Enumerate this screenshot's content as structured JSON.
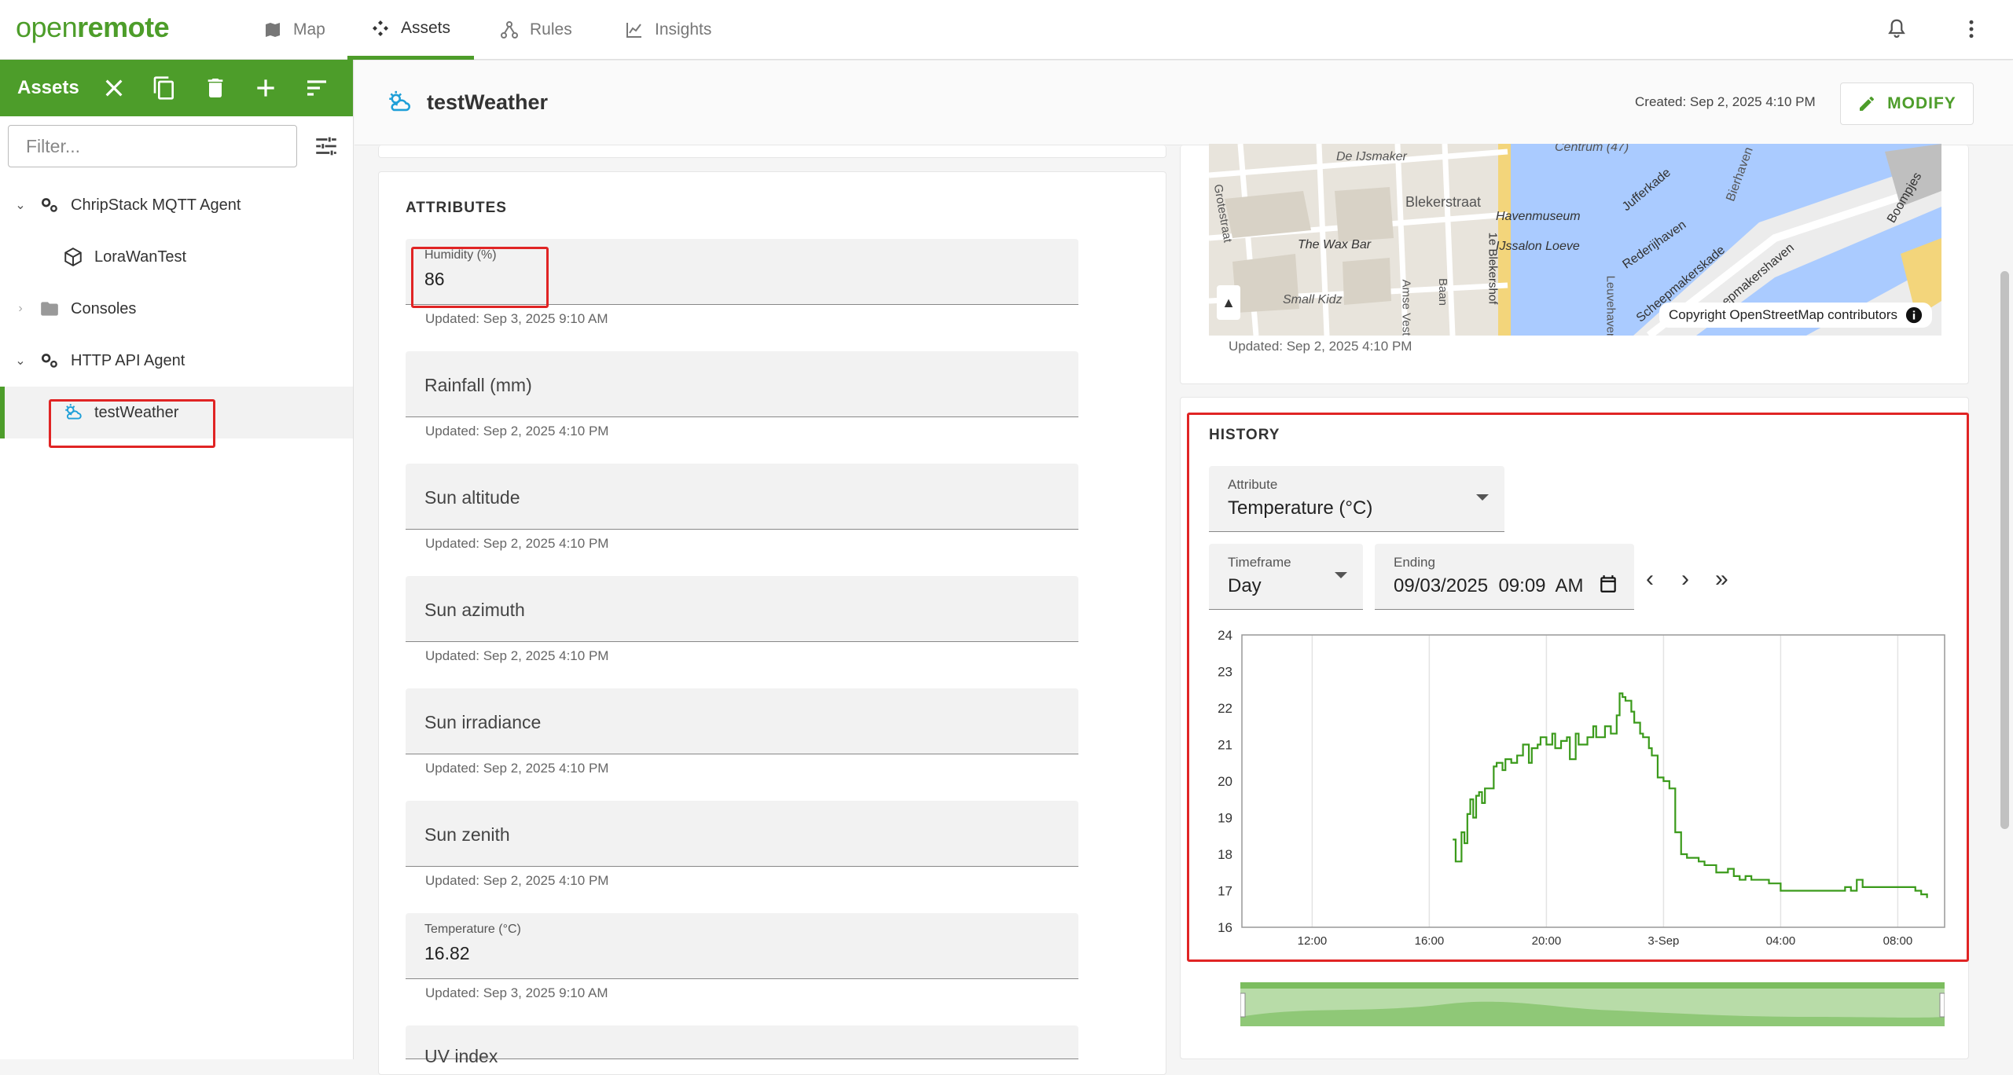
{
  "app": {
    "logo_part1": "open",
    "logo_part2": "remote",
    "nav_tabs": [
      {
        "label": "Map",
        "icon": "map-icon"
      },
      {
        "label": "Assets",
        "icon": "assets-icon",
        "active": true
      },
      {
        "label": "Rules",
        "icon": "rules-icon"
      },
      {
        "label": "Insights",
        "icon": "insights-icon"
      }
    ]
  },
  "sidebar": {
    "title": "Assets",
    "filter_placeholder": "Filter...",
    "tree": [
      {
        "label": "ChripStack MQTT Agent",
        "icon": "agent-icon",
        "expanded": true
      },
      {
        "label": "LoraWanTest",
        "icon": "cube-icon"
      },
      {
        "label": "Consoles",
        "icon": "folder-icon",
        "expanded": false
      },
      {
        "label": "HTTP API Agent",
        "icon": "agent-icon",
        "expanded": true
      },
      {
        "label": "testWeather",
        "icon": "weather-icon",
        "selected": true
      }
    ]
  },
  "header": {
    "asset_name": "testWeather",
    "created": "Created: Sep 2, 2025 4:10 PM",
    "modify_label": "MODIFY"
  },
  "attributes": {
    "title": "ATTRIBUTES",
    "items": [
      {
        "label": "Humidity (%)",
        "value": "86",
        "updated": "Updated: Sep 3, 2025 9:10 AM"
      },
      {
        "label": "Rainfall (mm)",
        "value": "",
        "updated": "Updated: Sep 2, 2025 4:10 PM"
      },
      {
        "label": "Sun altitude",
        "value": "",
        "updated": "Updated: Sep 2, 2025 4:10 PM"
      },
      {
        "label": "Sun azimuth",
        "value": "",
        "updated": "Updated: Sep 2, 2025 4:10 PM"
      },
      {
        "label": "Sun irradiance",
        "value": "",
        "updated": "Updated: Sep 2, 2025 4:10 PM"
      },
      {
        "label": "Sun zenith",
        "value": "",
        "updated": "Updated: Sep 2, 2025 4:10 PM"
      },
      {
        "label": "Temperature (°C)",
        "value": "16.82",
        "updated": "Updated: Sep 3, 2025 9:10 AM"
      },
      {
        "label": "UV index",
        "value": "",
        "updated": ""
      }
    ]
  },
  "location": {
    "copyright": "Copyright OpenStreetMap contributors",
    "updated": "Updated: Sep 2, 2025 4:10 PM",
    "streets": [
      "De IJsmaker",
      "Blekerstraat",
      "Havenmuseum",
      "IJssalon Loeve",
      "The Wax Bar",
      "Small Kidz",
      "Centrum (47)",
      "Jufferkade",
      "Rederijhaven",
      "Scheepmakerskade",
      "Bierhaven",
      "Scheepmakershaven",
      "Boompjes",
      "Leuvehaven",
      "1e Blekershof",
      "Baan",
      "Amse Vest",
      "Grotestraat"
    ]
  },
  "history": {
    "title": "HISTORY",
    "attribute_label": "Attribute",
    "attribute_value": "Temperature (°C)",
    "timeframe_label": "Timeframe",
    "timeframe_value": "Day",
    "ending_label": "Ending",
    "ending_value": "09/03/2025  09:09  AM",
    "nav_prev": "‹",
    "nav_next": "›",
    "nav_latest": "»"
  },
  "chart_data": {
    "type": "line",
    "xlabel": "",
    "ylabel": "",
    "xticks": [
      "12:00",
      "16:00",
      "20:00",
      "3-Sep",
      "04:00",
      "08:00"
    ],
    "xtick_hours": [
      12,
      16,
      20,
      24,
      28,
      32
    ],
    "xlim_hours": [
      9.6,
      33.6
    ],
    "ylim": [
      16,
      24
    ],
    "yticks": [
      16,
      17,
      18,
      19,
      20,
      21,
      22,
      23,
      24
    ],
    "grid": true,
    "color": "#3a9a1a",
    "series": [
      {
        "x_hours": [
          16.8,
          16.9,
          17.1,
          17.2,
          17.3,
          17.4,
          17.5,
          17.6,
          17.7,
          17.8,
          17.9,
          18.0,
          18.2,
          18.3,
          18.5,
          18.6,
          18.8,
          19.0,
          19.2,
          19.4,
          19.5,
          19.7,
          19.8,
          20.0,
          20.2,
          20.3,
          20.5,
          20.7,
          20.8,
          21.0,
          21.1,
          21.3,
          21.4,
          21.6,
          21.7,
          21.9,
          22.0,
          22.2,
          22.3,
          22.4,
          22.5,
          22.6,
          22.7,
          22.9,
          23.0,
          23.2,
          23.3,
          23.5,
          23.6,
          23.8,
          24.0,
          24.2,
          24.4,
          24.6,
          24.8,
          25.0,
          25.2,
          25.4,
          25.6,
          25.8,
          26.0,
          26.2,
          26.4,
          26.6,
          26.8,
          27.0,
          27.2,
          27.4,
          27.6,
          27.8,
          28.0,
          28.2,
          28.4,
          28.6,
          28.8,
          29.0,
          29.2,
          29.4,
          29.6,
          29.8,
          30.0,
          30.2,
          30.4,
          30.6,
          30.8,
          31.0,
          31.2,
          31.4,
          31.6,
          31.8,
          32.0,
          32.2,
          32.4,
          32.6,
          32.8,
          33.0
        ],
        "y": [
          18.4,
          17.8,
          18.6,
          18.3,
          19.1,
          19.5,
          19.0,
          19.6,
          19.7,
          19.4,
          19.8,
          19.8,
          20.4,
          20.5,
          20.3,
          20.6,
          20.5,
          20.7,
          21.0,
          20.5,
          20.9,
          21.0,
          21.2,
          21.0,
          21.3,
          20.9,
          21.1,
          21.2,
          20.6,
          21.3,
          21.0,
          21.0,
          21.2,
          21.5,
          21.2,
          21.2,
          21.5,
          21.3,
          21.3,
          21.8,
          22.4,
          22.3,
          22.2,
          21.9,
          21.6,
          21.3,
          21.2,
          20.9,
          20.7,
          20.1,
          20.0,
          19.8,
          18.6,
          18.0,
          17.9,
          17.9,
          17.8,
          17.7,
          17.7,
          17.5,
          17.5,
          17.6,
          17.4,
          17.3,
          17.4,
          17.3,
          17.3,
          17.3,
          17.2,
          17.2,
          17.0,
          17.0,
          17.0,
          17.0,
          17.0,
          17.0,
          17.0,
          17.0,
          17.0,
          17.0,
          17.0,
          17.1,
          17.0,
          17.3,
          17.1,
          17.1,
          17.1,
          17.1,
          17.1,
          17.1,
          17.1,
          17.1,
          17.1,
          17.0,
          16.9,
          16.8
        ]
      }
    ]
  }
}
